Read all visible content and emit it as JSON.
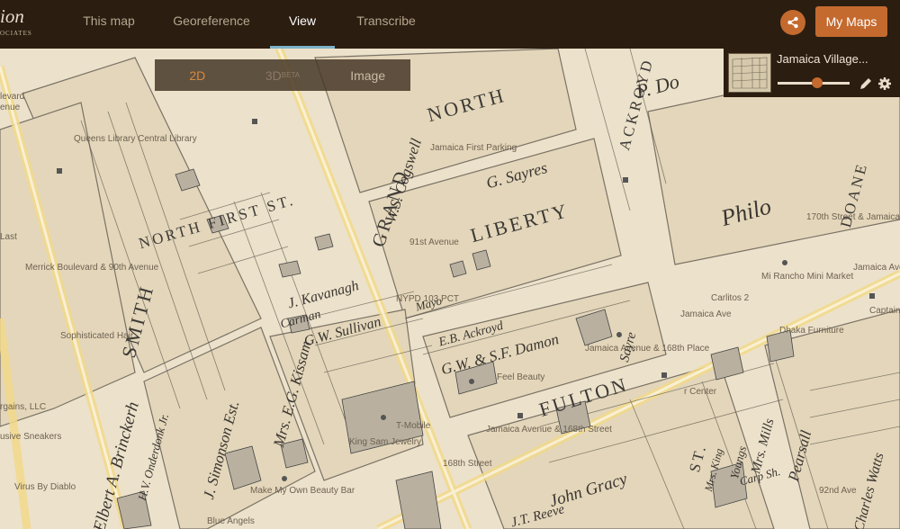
{
  "topbar": {
    "logo_text": "ion",
    "logo_sub": "OCIATES",
    "tabs": [
      {
        "label": "This map",
        "active": false
      },
      {
        "label": "Georeference",
        "active": false
      },
      {
        "label": "View",
        "active": true
      },
      {
        "label": "Transcribe",
        "active": false
      }
    ],
    "share_icon": "share-icon",
    "my_maps_label": "My Maps",
    "accent_color": "#c46a2f"
  },
  "view_mode": {
    "options": [
      {
        "label": "2D",
        "active": true
      },
      {
        "label": "3D",
        "sup": "BETA",
        "active": false
      },
      {
        "label": "Image",
        "active": false
      }
    ]
  },
  "layer": {
    "title": "Jamaica Village...",
    "opacity_value": 0.55
  },
  "map_labels": {
    "poi": [
      "Queens Library Central Library",
      "Jamaica First Parking",
      "170th Street & Jamaica Avenue",
      "Merrick Boulevard & 90th Avenue",
      "Sophisticated Hair",
      "91st Avenue",
      "NYPD 103 PCT",
      "Jamaica Avenue & 168th Place",
      "Feel Beauty",
      "Mi Rancho Mini Market",
      "Carlitos 2",
      "Dhaka Furniture",
      "Captain Kw",
      "Jamaica Avenue & 168th Street",
      "Make My Own Beauty Bar",
      "Blue Angels",
      "Virus By Diablo",
      "rgains, LLC",
      "usive Sneakers",
      "Last",
      "levard",
      "enue",
      "King Sam Jewelry",
      "T-Mobile",
      "Jamaica Ave",
      "Jamaica Avenue",
      "168th Street",
      "92nd Ave",
      "r Center"
    ],
    "historic_streets": [
      "NORTH",
      "NORTH FIRST ST.",
      "GRAND",
      "LIBERTY",
      "FULTON",
      "SMITH",
      "ACKROYD",
      "DOANE",
      "ST."
    ],
    "historic_owners": [
      "P. Do",
      "W.S. Cogswell",
      "G. Sayres",
      "Philo",
      "J. Kavanagh",
      "G.W. Sullivan",
      "Mrs. E.G. Kissam",
      "J. Simonson Est.",
      "H.V. Onderdonk Jr.",
      "Elbert A. Brinckerh",
      "E.B. Ackroyd",
      "G.W. & S.F. Damon",
      "John Gracy",
      "Mrs. Mills",
      "Pearsall",
      "Charles Watts",
      "J.T. Reeve",
      "Carp Sh.",
      "Mrs. King",
      "Youngs",
      "Carman",
      "Mayo",
      "Sayre"
    ]
  }
}
